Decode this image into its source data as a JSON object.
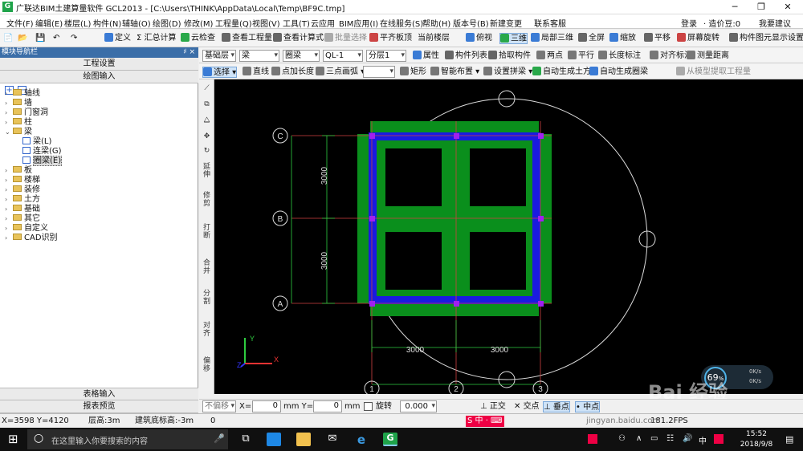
{
  "titlebar": {
    "title": "广联达BIM土建算量软件 GCL2013 - [C:\\Users\\THINK\\AppData\\Local\\Temp\\BF9C.tmp]",
    "app_icon": "G",
    "minimize": "─",
    "maximize": "❐",
    "close": "✕"
  },
  "menu": [
    "文件(F)",
    "编辑(E)",
    "楼层(L)",
    "构件(N)",
    "辅轴(O)",
    "绘图(D)",
    "修改(M)",
    "工程量(Q)",
    "视图(V)",
    "工具(T)",
    "云应用",
    "BIM应用(I)",
    "在线服务(S)",
    "帮助(H)",
    "版本号(B)",
    "新建变更",
    "联系客服"
  ],
  "menu_right": {
    "login": "登录",
    "price": "· 造价豆:0",
    "suggest": "我要建议"
  },
  "toolbar1": {
    "define": "定义",
    "sum": "Σ 汇总计算",
    "cloud_check": "云检查",
    "view_qty": "查看工程量",
    "view_formula": "查看计算式",
    "batch_select": "批量选择",
    "align_top": "平齐板顶",
    "current_floor": "当前楼层",
    "top_view": "俯视",
    "three_d": "三维",
    "local_3d": "局部三维",
    "fullscreen": "全屏",
    "zoom": "缩放",
    "pan": "平移",
    "rotate": "屏幕旋转",
    "display_settings": "构件图元显示设置"
  },
  "leftpanel": {
    "header": "模块导航栏",
    "pin": "♯ ×",
    "project_settings": "工程设置",
    "draw_input": "绘图输入",
    "add": "+",
    "remove": "−",
    "table_input": "表格输入",
    "report_preview": "报表预览"
  },
  "tree": [
    {
      "label": "轴线",
      "level": 0,
      "type": "folder"
    },
    {
      "label": "墙",
      "level": 0,
      "type": "folder"
    },
    {
      "label": "门窗洞",
      "level": 0,
      "type": "folder"
    },
    {
      "label": "柱",
      "level": 0,
      "type": "folder"
    },
    {
      "label": "梁",
      "level": 0,
      "type": "folder",
      "expanded": true
    },
    {
      "label": "梁(L)",
      "level": 1,
      "type": "leaf"
    },
    {
      "label": "连梁(G)",
      "level": 1,
      "type": "leaf"
    },
    {
      "label": "圈梁(E)",
      "level": 1,
      "type": "leaf",
      "selected": true
    },
    {
      "label": "板",
      "level": 0,
      "type": "folder"
    },
    {
      "label": "楼梯",
      "level": 0,
      "type": "folder"
    },
    {
      "label": "装修",
      "level": 0,
      "type": "folder"
    },
    {
      "label": "土方",
      "level": 0,
      "type": "folder"
    },
    {
      "label": "基础",
      "level": 0,
      "type": "folder"
    },
    {
      "label": "其它",
      "level": 0,
      "type": "folder"
    },
    {
      "label": "自定义",
      "level": 0,
      "type": "folder"
    },
    {
      "label": "CAD识别",
      "level": 0,
      "type": "folder"
    }
  ],
  "toolbar2": {
    "floor": "基础层",
    "type": "梁",
    "subtype": "圈梁",
    "name": "QL-1",
    "layer": "分层1",
    "properties": "属性",
    "component_list": "构件列表",
    "pick": "拾取构件",
    "two_points": "两点",
    "parallel": "平行",
    "length_mark": "长度标注",
    "align_mark": "对齐标注",
    "measure": "测量距离"
  },
  "toolbar3": {
    "select": "选择",
    "line": "直线",
    "point_length": "点加长度",
    "arc": "三点画弧",
    "rect": "矩形",
    "smart_layout": "智能布置",
    "splice": "设置拼梁",
    "auto_earth": "自动生成土方",
    "auto_ringbeam": "自动生成圈梁",
    "extract": "从模型提取工程量"
  },
  "vtools": [
    "延伸",
    "修剪",
    "打断",
    "合并",
    "分割",
    "对齐",
    "偏移"
  ],
  "drawing": {
    "grid_rows": [
      "C",
      "B",
      "A"
    ],
    "grid_cols": [
      "1",
      "2",
      "3"
    ],
    "dim_h": [
      "3000",
      "3000"
    ],
    "dim_v": [
      "3000",
      "3000"
    ],
    "axis_x": "X",
    "axis_y": "Y",
    "axis_z": "Z"
  },
  "statusctl": {
    "no_offset": "不偏移",
    "x_label": "X=",
    "x_val": "0",
    "unit1": "mm Y=",
    "y_val": "0",
    "unit2": "mm",
    "rotate": "旋转",
    "rot_val": "0.000",
    "ortho": "正交",
    "intersect": "交点",
    "perp": "垂点",
    "mid": "中点"
  },
  "statusbar": {
    "coords": "X=3598 Y=4120",
    "floor_height": "层高:3m",
    "bottom_elev": "建筑底标高:-3m",
    "zero": "0",
    "right_val": "181.2FPS"
  },
  "perf": {
    "percent": "69",
    "unit": "%",
    "up": "0K/s",
    "down": "0K/s"
  },
  "watermark": {
    "text": "Bai 经验",
    "url": "jingyan.baidu.com"
  },
  "taskbar": {
    "search": "在这里输入你要搜索的内容",
    "time": "15:52",
    "date": "2018/9/8",
    "ime": "中"
  },
  "colors": {
    "canvas": "#000000",
    "beam_green": "#0a8f1c",
    "beam_blue": "#1a1ae0",
    "node": "#a020f0",
    "grid": "#d04040"
  }
}
